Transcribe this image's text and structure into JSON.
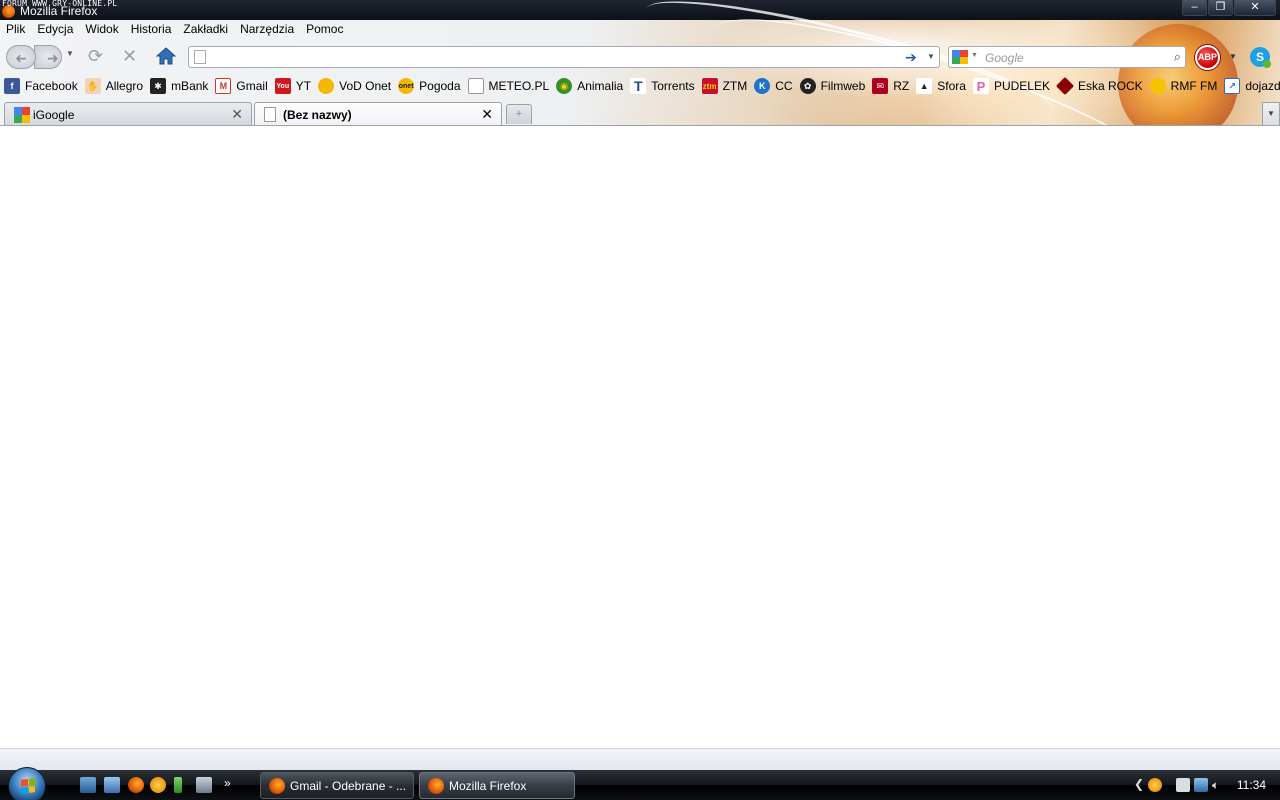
{
  "window": {
    "watermark": "FORUM WWW.GRY-ONLINE.PL",
    "title": "Mozilla Firefox",
    "minimize_label": "–",
    "maximize_label": "❐",
    "close_label": "✕"
  },
  "menubar": {
    "items": [
      {
        "label": "Plik"
      },
      {
        "label": "Edycja"
      },
      {
        "label": "Widok"
      },
      {
        "label": "Historia"
      },
      {
        "label": "Zakładki"
      },
      {
        "label": "Narzędzia"
      },
      {
        "label": "Pomoc"
      }
    ]
  },
  "navbar": {
    "url_value": "",
    "search_placeholder": "Google",
    "adblock_label": "ABP"
  },
  "bookmarks": {
    "items": [
      {
        "label": "Facebook",
        "icon": "facebook-icon",
        "color": "#3b5998"
      },
      {
        "label": "Allegro",
        "icon": "allegro-icon",
        "color": "#ff6a00"
      },
      {
        "label": "mBank",
        "icon": "mbank-icon",
        "color": "#c8102e"
      },
      {
        "label": "Gmail",
        "icon": "gmail-icon",
        "color": "#d93025"
      },
      {
        "label": "YT",
        "icon": "youtube-icon",
        "color": "#cc181e"
      },
      {
        "label": "VoD Onet",
        "icon": "sun-icon",
        "color": "#f5b800"
      },
      {
        "label": "Pogoda",
        "icon": "onet-icon",
        "color": "#f5b800"
      },
      {
        "label": "METEO.PL",
        "icon": "page-icon",
        "color": "#ffffff"
      },
      {
        "label": "Animalia",
        "icon": "animalia-icon",
        "color": "#3a8f2b"
      },
      {
        "label": "Torrents",
        "icon": "torrents-icon",
        "color": "#1a4f8a"
      },
      {
        "label": "ZTM",
        "icon": "ztm-icon",
        "color": "#c8102e"
      },
      {
        "label": "CC",
        "icon": "cc-icon",
        "color": "#1e73c8"
      },
      {
        "label": "Filmweb",
        "icon": "filmweb-icon",
        "color": "#c00000"
      },
      {
        "label": "RZ",
        "icon": "rz-icon",
        "color": "#b00020"
      },
      {
        "label": "Sfora",
        "icon": "sfora-icon",
        "color": "#333333"
      },
      {
        "label": "PUDELEK",
        "icon": "pudelek-icon",
        "color": "#e85ea8"
      },
      {
        "label": "Eska ROCK",
        "icon": "eska-icon",
        "color": "#8b0000"
      },
      {
        "label": "RMF FM",
        "icon": "sun-icon",
        "color": "#f5c400"
      },
      {
        "label": "dojazdy",
        "icon": "dojazdy-icon",
        "color": "#2a6ac8"
      }
    ]
  },
  "tabs": {
    "items": [
      {
        "label": "iGoogle",
        "active": false
      },
      {
        "label": "(Bez nazwy)",
        "active": true
      }
    ],
    "close_glyph": "✕",
    "new_tab_glyph": "+"
  },
  "taskbar": {
    "more_glyph": "»",
    "tasks": [
      {
        "label": "Gmail - Odebrane - ...",
        "active": false
      },
      {
        "label": "Mozilla Firefox",
        "active": true
      }
    ],
    "clock": "11:34"
  }
}
